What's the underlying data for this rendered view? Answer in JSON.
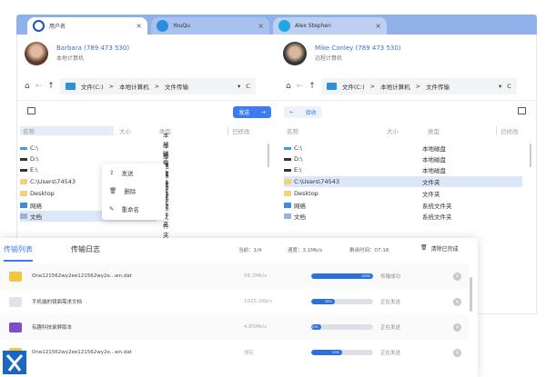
{
  "tabs": [
    {
      "label": "用户名",
      "close": "×"
    },
    {
      "label": "YouQu",
      "close": "×"
    },
    {
      "label": "Alex Stephen",
      "close": "×"
    }
  ],
  "left": {
    "user": "Barbara (789 473 530)",
    "role": "本地计算机",
    "path": [
      "文件(C:)",
      "本地计算机",
      "文件传输"
    ],
    "action": "发送",
    "action_icon": "→"
  },
  "right": {
    "user": "Mike Conley (789 473 530)",
    "role": "远程计算机",
    "path": [
      "文件(C:)",
      "本地计算机",
      "文件传输"
    ],
    "action": "接收",
    "action_icon": "←"
  },
  "nav": {
    "home": "⌂",
    "back": "←",
    "up": "↑",
    "dropdown": "▾",
    "refresh": "C",
    "sep": ">"
  },
  "columns": {
    "name": "名称",
    "size": "大小",
    "type": "类型",
    "modified": "已修改"
  },
  "files": [
    {
      "name": "C:\\",
      "type": "本地磁盘"
    },
    {
      "name": "D:\\",
      "type": "本地磁盘"
    },
    {
      "name": "E:\\",
      "type": "本地磁盘"
    },
    {
      "name": "C:\\Users\\74543",
      "type": "文件夹"
    },
    {
      "name": "Desktop",
      "type": "文件夹"
    },
    {
      "name": "网络",
      "type": "系统文件夹"
    },
    {
      "name": "文档",
      "type": "系统文件夹"
    }
  ],
  "context_menu": [
    "发送",
    "删除",
    "重命名"
  ],
  "transfer": {
    "tabs": [
      "传输列表",
      "传输日志"
    ],
    "current": "当前：1/4",
    "speed": "速度：3.1Mb/s",
    "remaining": "剩余时间：07:16",
    "clear": "清除已完成",
    "items": [
      {
        "name": "One121562wy2ee121562wy2e...wn.dat",
        "rate": "56.2Mb/s",
        "progress": 100,
        "label": "100%",
        "status": "传输成功",
        "color": "#f5c542"
      },
      {
        "name": "手机端的镜面需求文档",
        "rate": "1025.2Kb/s",
        "progress": 38,
        "label": "38%",
        "status": "正在发送",
        "color": "#dfe3ee"
      },
      {
        "name": "有趣科技录屏版本",
        "rate": "4.85Mb/s",
        "progress": 10,
        "label": "10%",
        "status": "正在发送",
        "color": "#7b4fc9"
      },
      {
        "name": "One121562wy2ee121562wy2e...wn.dat",
        "rate": "排队",
        "progress": 50,
        "label": "50%",
        "status": "正在发送",
        "color": "#f5c542"
      }
    ]
  }
}
